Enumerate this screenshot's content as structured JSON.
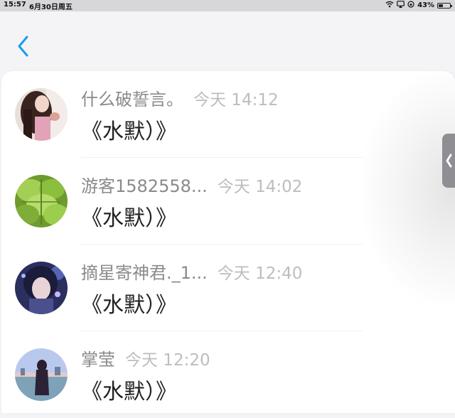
{
  "status_bar": {
    "time": "15:57",
    "date": "6月30日周五",
    "battery": "43%",
    "battery_level": 0.43
  },
  "header": {
    "back_icon": "chevron-left-icon"
  },
  "colors": {
    "accent": "#1a9cf0",
    "handle": "#8e8e93"
  },
  "comments": [
    {
      "user": "什么破誓言。",
      "time": "今天 14:12",
      "text": "《水默）》",
      "avatar": "anime-girl"
    },
    {
      "user": "游客1582558...",
      "time": "今天 14:02",
      "text": "《水默）》",
      "avatar": "green-leaves"
    },
    {
      "user": "摘星寄神君._1...",
      "time": "今天 12:40",
      "text": "《水默）》",
      "avatar": "anime-boy"
    },
    {
      "user": "掌莹",
      "time": "今天 12:20",
      "text": "《水默）》",
      "avatar": "silhouette-sunset"
    }
  ]
}
